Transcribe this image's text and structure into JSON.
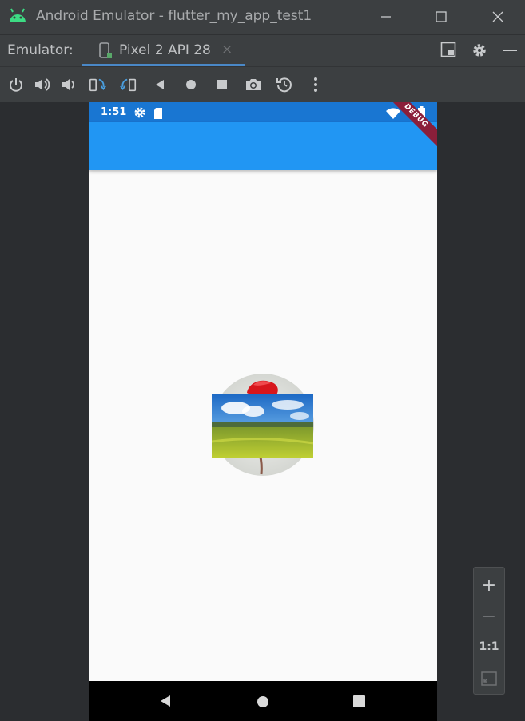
{
  "window": {
    "title": "Android Emulator - flutter_my_app_test1"
  },
  "tabbar": {
    "label": "Emulator:",
    "device_tab": "Pixel 2 API 28",
    "close_glyph": "×"
  },
  "toolbar": {
    "items": [
      "power-icon",
      "volume-up-icon",
      "volume-down-icon",
      "rotate-left-icon",
      "rotate-right-icon",
      "back-icon",
      "home-icon",
      "overview-icon",
      "camera-icon",
      "snapshot-icon",
      "more-icon"
    ]
  },
  "device": {
    "status_time": "1:51",
    "debug_banner": "DEBUG"
  },
  "zoom": {
    "zoom_in": "+",
    "zoom_out": "−",
    "actual_size": "1:1"
  },
  "colors": {
    "status_bar": "#1976d2",
    "app_bar": "#2196f3",
    "debug_banner": "#8b1f3a",
    "chrome": "#3c3f41"
  }
}
